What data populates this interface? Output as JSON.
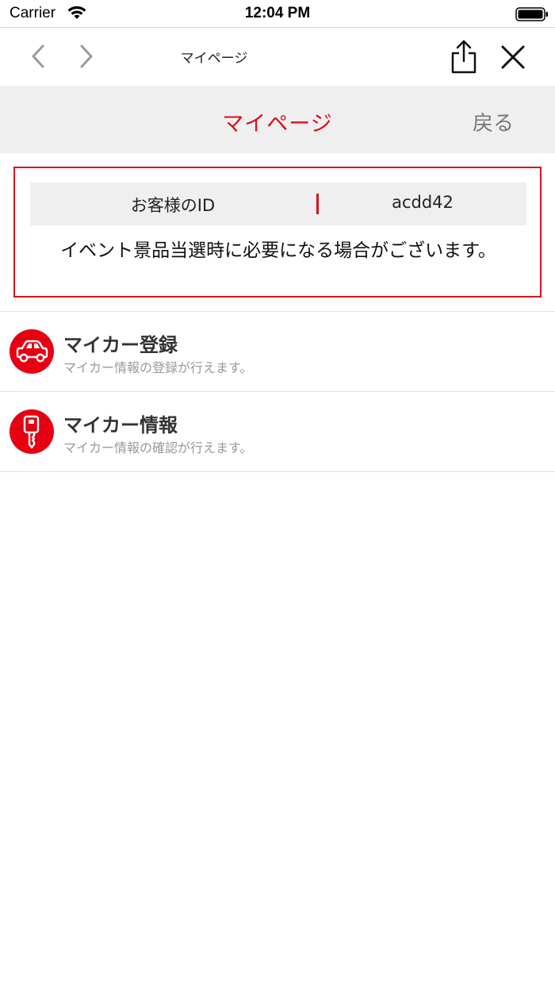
{
  "status_bar": {
    "carrier": "Carrier",
    "time": "12:04 PM"
  },
  "toolbar": {
    "title": "マイページ"
  },
  "header": {
    "title": "マイページ",
    "back_label": "戻る"
  },
  "id_box": {
    "label": "お客様のID",
    "value": "acdd42",
    "note": "イベント景品当選時に必要になる場合がございます。"
  },
  "menu": [
    {
      "title": "マイカー登録",
      "subtitle": "マイカー情報の登録が行えます。",
      "icon": "car-icon"
    },
    {
      "title": "マイカー情報",
      "subtitle": "マイカー情報の確認が行えます。",
      "icon": "key-icon"
    }
  ],
  "colors": {
    "accent": "#d8121b",
    "icon_bg": "#e60012",
    "header_bg": "#efefef",
    "muted_text": "#999999"
  }
}
